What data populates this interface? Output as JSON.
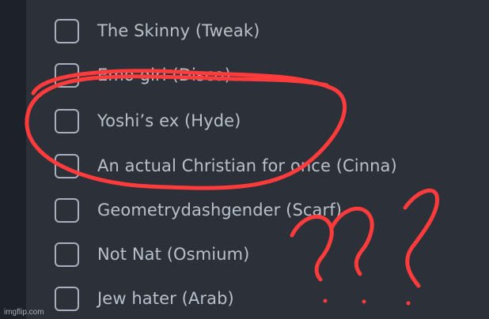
{
  "colors": {
    "background": "#2b3039",
    "left_rail": "#1d222a",
    "checkbox_border": "#a9b0bb",
    "label_text": "#b9c0ca",
    "annotation_red": "#ff3b3b"
  },
  "list": {
    "items": [
      {
        "label": "The Skinny (Tweak)",
        "checked": false
      },
      {
        "label": "Emo girl (Disco)",
        "checked": false
      },
      {
        "label": "Yoshi’s ex (Hyde)",
        "checked": false
      },
      {
        "label": "An actual Christian for once (Cinna)",
        "checked": false
      },
      {
        "label": "Geometrydashgender (Scarf)",
        "checked": false
      },
      {
        "label": "Not Nat (Osmium)",
        "checked": false
      },
      {
        "label": "Jew hater (Arab)",
        "checked": false
      }
    ]
  },
  "annotation": {
    "marks_text": "???"
  },
  "watermark": {
    "text": "imgflip.com"
  }
}
